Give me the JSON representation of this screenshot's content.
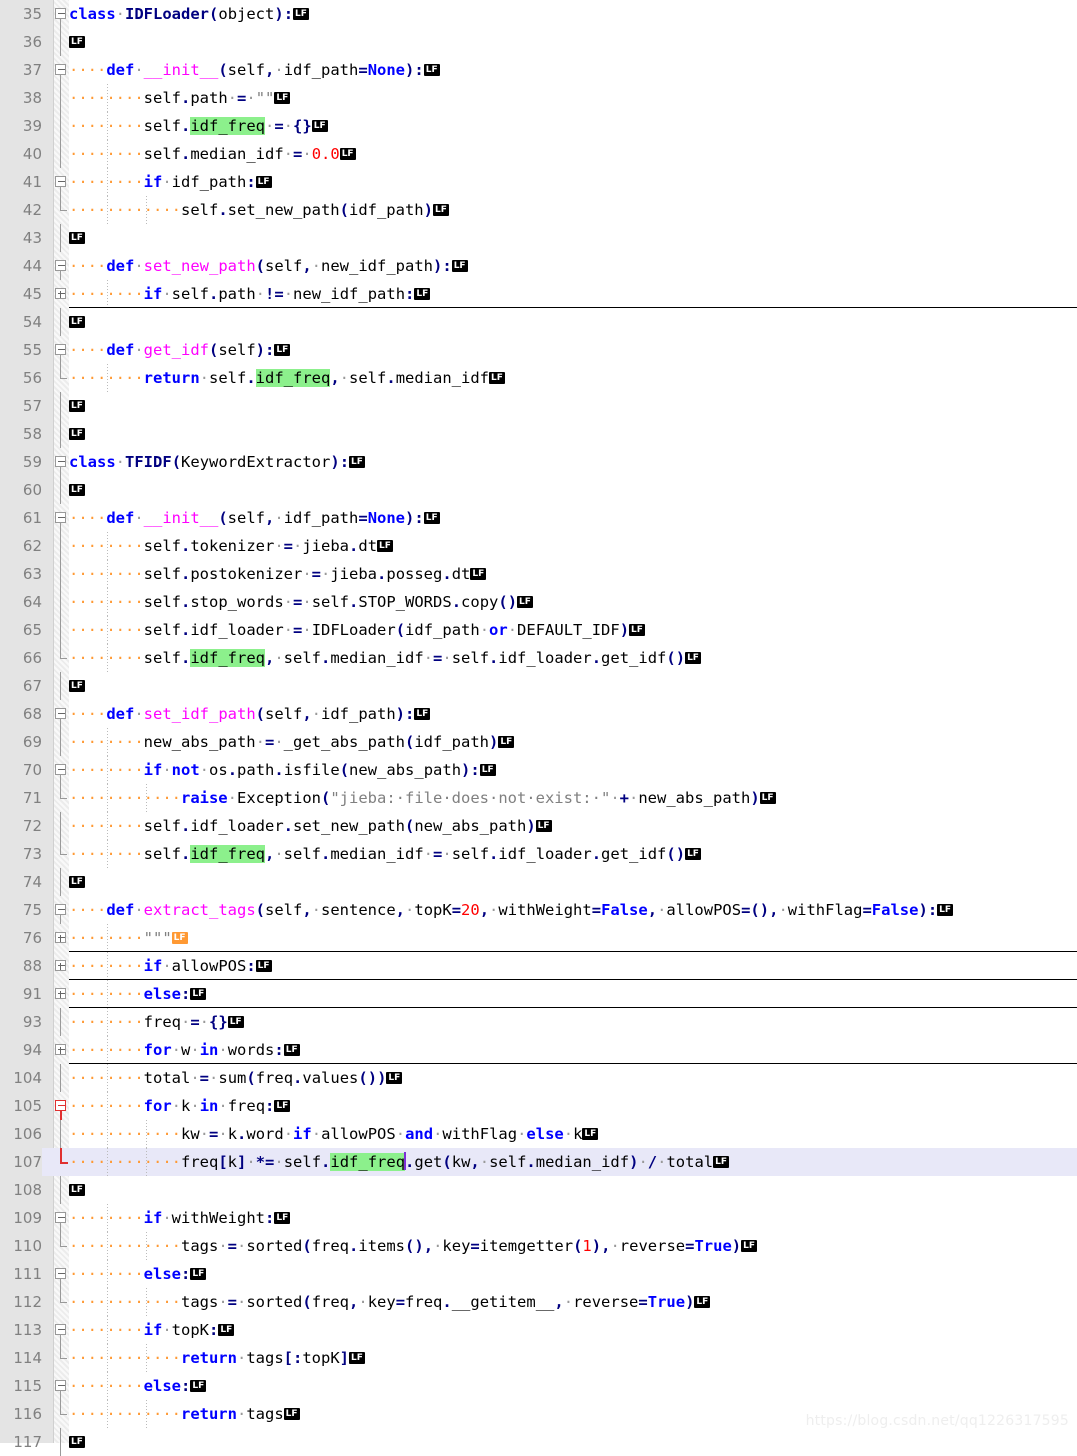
{
  "editor": {
    "language": "Python",
    "eol_marker_label": "LF",
    "highlighted_token": "idf_freq",
    "current_line": 107,
    "watermark": "https://blog.csdn.net/qq1226317595",
    "colors": {
      "gutter_bg": "#e4e4e4",
      "line_number": "#808080",
      "current_line_bg": "#e8e8f8",
      "occurrence_highlight": "#8cf08c",
      "keyword": "#0000ff",
      "function_name": "#ff00ff",
      "string": "#808080",
      "number": "#ff0000",
      "punctuation": "#000080",
      "whitespace_dot": "#ff9933",
      "fold_marker_active": "#e03030",
      "caret": "#7b2fd6"
    }
  },
  "lines": [
    {
      "n": 35,
      "fold": "open",
      "text": "class IDFLoader(object):"
    },
    {
      "n": 36,
      "fold": "",
      "text": ""
    },
    {
      "n": 37,
      "fold": "open",
      "text": "    def __init__(self, idf_path=None):"
    },
    {
      "n": 38,
      "fold": "",
      "text": "        self.path = \"\""
    },
    {
      "n": 39,
      "fold": "",
      "text": "        self.idf_freq = {}"
    },
    {
      "n": 40,
      "fold": "",
      "text": "        self.median_idf = 0.0"
    },
    {
      "n": 41,
      "fold": "open",
      "text": "        if idf_path:"
    },
    {
      "n": 42,
      "fold": "end",
      "text": "            self.set_new_path(idf_path)"
    },
    {
      "n": 43,
      "fold": "",
      "text": ""
    },
    {
      "n": 44,
      "fold": "open",
      "text": "    def set_new_path(self, new_idf_path):"
    },
    {
      "n": 45,
      "fold": "closed",
      "text": "        if self.path != new_idf_path:"
    },
    {
      "n": 54,
      "fold": "",
      "text": ""
    },
    {
      "n": 55,
      "fold": "open",
      "text": "    def get_idf(self):"
    },
    {
      "n": 56,
      "fold": "end",
      "text": "        return self.idf_freq, self.median_idf"
    },
    {
      "n": 57,
      "fold": "",
      "text": ""
    },
    {
      "n": 58,
      "fold": "",
      "text": ""
    },
    {
      "n": 59,
      "fold": "open",
      "text": "class TFIDF(KeywordExtractor):"
    },
    {
      "n": 60,
      "fold": "",
      "text": ""
    },
    {
      "n": 61,
      "fold": "open",
      "text": "    def __init__(self, idf_path=None):"
    },
    {
      "n": 62,
      "fold": "",
      "text": "        self.tokenizer = jieba.dt"
    },
    {
      "n": 63,
      "fold": "",
      "text": "        self.postokenizer = jieba.posseg.dt"
    },
    {
      "n": 64,
      "fold": "",
      "text": "        self.stop_words = self.STOP_WORDS.copy()"
    },
    {
      "n": 65,
      "fold": "",
      "text": "        self.idf_loader = IDFLoader(idf_path or DEFAULT_IDF)"
    },
    {
      "n": 66,
      "fold": "end",
      "text": "        self.idf_freq, self.median_idf = self.idf_loader.get_idf()"
    },
    {
      "n": 67,
      "fold": "",
      "text": ""
    },
    {
      "n": 68,
      "fold": "open",
      "text": "    def set_idf_path(self, idf_path):"
    },
    {
      "n": 69,
      "fold": "",
      "text": "        new_abs_path = _get_abs_path(idf_path)"
    },
    {
      "n": 70,
      "fold": "open",
      "text": "        if not os.path.isfile(new_abs_path):"
    },
    {
      "n": 71,
      "fold": "end",
      "text": "            raise Exception(\"jieba: file does not exist: \" + new_abs_path)"
    },
    {
      "n": 72,
      "fold": "",
      "text": "        self.idf_loader.set_new_path(new_abs_path)"
    },
    {
      "n": 73,
      "fold": "end",
      "text": "        self.idf_freq, self.median_idf = self.idf_loader.get_idf()"
    },
    {
      "n": 74,
      "fold": "",
      "text": ""
    },
    {
      "n": 75,
      "fold": "open",
      "text": "    def extract_tags(self, sentence, topK=20, withWeight=False, allowPOS=(), withFlag=False):"
    },
    {
      "n": 76,
      "fold": "closed",
      "text": "        \"\"\""
    },
    {
      "n": 88,
      "fold": "closed",
      "text": "        if allowPOS:"
    },
    {
      "n": 91,
      "fold": "closed",
      "text": "        else:"
    },
    {
      "n": 93,
      "fold": "",
      "text": "        freq = {}"
    },
    {
      "n": 94,
      "fold": "closed",
      "text": "        for w in words:"
    },
    {
      "n": 104,
      "fold": "",
      "text": "        total = sum(freq.values())"
    },
    {
      "n": 105,
      "fold": "open-active",
      "text": "        for k in freq:"
    },
    {
      "n": 106,
      "fold": "",
      "text": "            kw = k.word if allowPOS and withFlag else k"
    },
    {
      "n": 107,
      "fold": "end-active",
      "text": "            freq[k] *= self.idf_freq.get(kw, self.median_idf) / total"
    },
    {
      "n": 108,
      "fold": "",
      "text": ""
    },
    {
      "n": 109,
      "fold": "open",
      "text": "        if withWeight:"
    },
    {
      "n": 110,
      "fold": "end",
      "text": "            tags = sorted(freq.items(), key=itemgetter(1), reverse=True)"
    },
    {
      "n": 111,
      "fold": "open",
      "text": "        else:"
    },
    {
      "n": 112,
      "fold": "end",
      "text": "            tags = sorted(freq, key=freq.__getitem__, reverse=True)"
    },
    {
      "n": 113,
      "fold": "open",
      "text": "        if topK:"
    },
    {
      "n": 114,
      "fold": "end",
      "text": "            return tags[:topK]"
    },
    {
      "n": 115,
      "fold": "open",
      "text": "        else:"
    },
    {
      "n": 116,
      "fold": "end",
      "text": "            return tags"
    },
    {
      "n": 117,
      "fold": "",
      "text": ""
    }
  ]
}
